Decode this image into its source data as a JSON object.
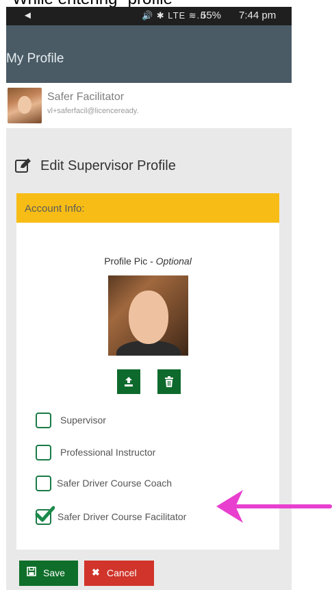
{
  "caption": "While entering \"profile\"",
  "status_bar": {
    "back_glyph": "◄",
    "icons": "🔊 ✱ LTE ≋.ıl",
    "battery": "55%",
    "time": "7:44 pm"
  },
  "app_bar": {
    "title": "My Profile"
  },
  "user": {
    "name": "Safer Facilitator",
    "email": "vl+saferfacil@licenceready."
  },
  "page_title": "Edit Supervisor Profile",
  "account_info": {
    "header": "Account Info:",
    "profile_pic_label": "Profile Pic - ",
    "profile_pic_optional": "Optional",
    "upload_icon": "upload-icon",
    "delete_icon": "trash-icon"
  },
  "roles": [
    {
      "label": "Supervisor",
      "checked": false
    },
    {
      "label": "Professional Instructor",
      "checked": false
    },
    {
      "label": "Safer Driver Course Coach",
      "checked": false
    },
    {
      "label": "Safer Driver Course Facilitator",
      "checked": true
    }
  ],
  "actions": {
    "save_label": "Save",
    "cancel_label": "Cancel"
  },
  "colors": {
    "app_bar": "#4a5b66",
    "card_header": "#f7bd16",
    "green": "#0f6e2a",
    "red": "#d0342a",
    "arrow": "#e83fcf"
  }
}
